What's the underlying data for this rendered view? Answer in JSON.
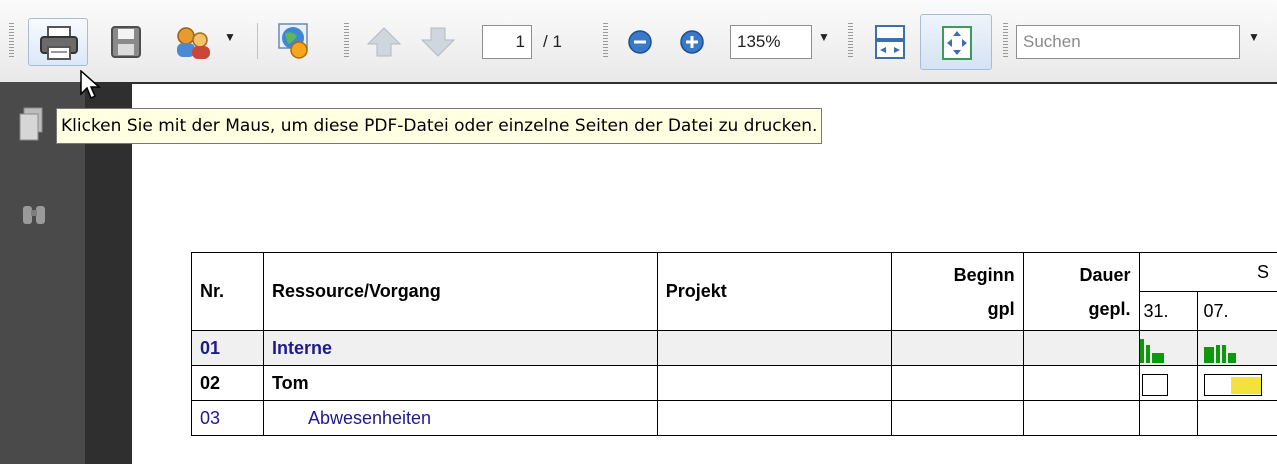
{
  "toolbar": {
    "page_current": "1",
    "page_total": "/ 1",
    "zoom": "135%",
    "search_placeholder": "Suchen",
    "icons": [
      "print-icon",
      "save-icon",
      "share-icon",
      "globe-icon",
      "prev-page-icon",
      "next-page-icon",
      "zoom-out-icon",
      "zoom-in-icon",
      "fit-width-icon",
      "fit-page-icon"
    ]
  },
  "tooltip": "Klicken Sie mit der Maus, um diese PDF-Datei oder einzelne Seiten der Datei zu drucken.",
  "table": {
    "headers": {
      "nr": "Nr.",
      "ressource": "Ressource/Vorgang",
      "projekt": "Projekt",
      "beginn1": "Beginn",
      "beginn2": "gpl",
      "dauer1": "Dauer",
      "dauer2": "gepl.",
      "month": "S",
      "day1": "31.",
      "day2": "07."
    },
    "rows": [
      {
        "nr": "01",
        "name": "Interne"
      },
      {
        "nr": "02",
        "name": "Tom"
      },
      {
        "nr": "03",
        "name": "Abwesenheiten"
      }
    ]
  },
  "colors": {
    "accent_blue": "#1f1a8f",
    "gantt_green": "#0a9a0a",
    "gantt_yellow": "#f3e23a",
    "tooltip_bg": "#ffffe1"
  }
}
